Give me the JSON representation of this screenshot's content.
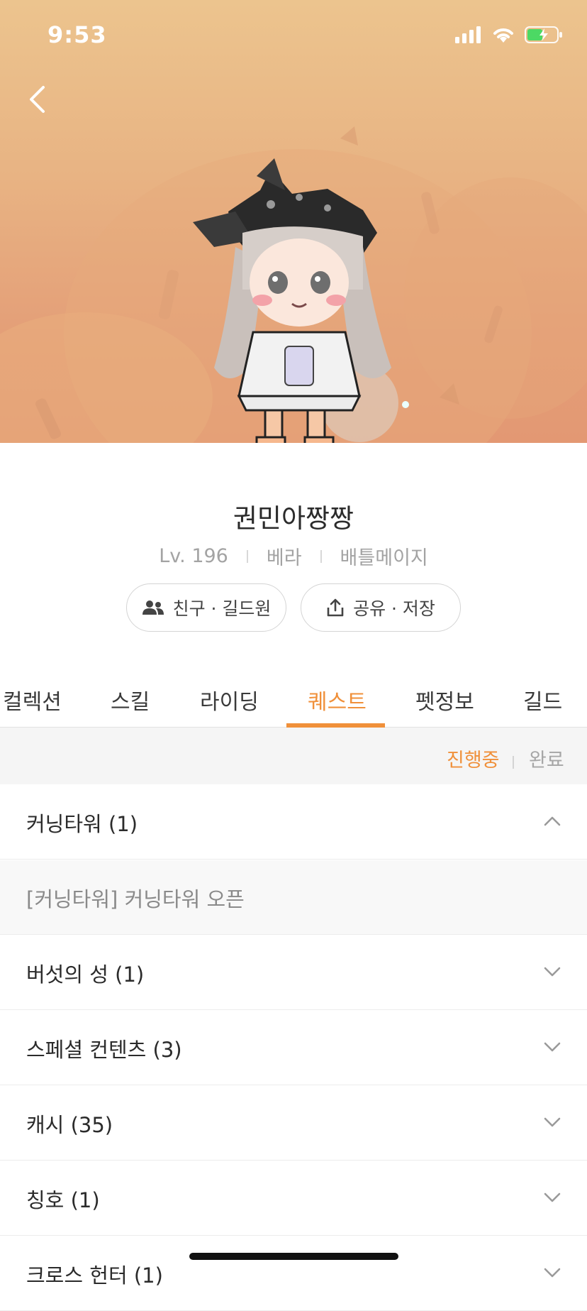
{
  "status_bar": {
    "time": "9:53"
  },
  "profile": {
    "name": "권민아짱짱",
    "level": "Lv. 196",
    "world": "베라",
    "job": "배틀메이지",
    "friend_button": "친구 · 길드원",
    "share_button": "공유 · 저장"
  },
  "tabs": [
    "컬렉션",
    "스킬",
    "라이딩",
    "퀘스트",
    "펫정보",
    "길드"
  ],
  "active_tab": "퀘스트",
  "filter": {
    "in_progress": "진행중",
    "done": "완료"
  },
  "quest_groups": [
    {
      "label": "커닝타워 (1)",
      "expanded": true
    },
    {
      "label": "[커닝타워] 커닝타워 오픈",
      "sub": true
    },
    {
      "label": "버섯의 성 (1)"
    },
    {
      "label": "스페셜 컨텐츠 (3)"
    },
    {
      "label": "캐시 (35)"
    },
    {
      "label": "칭호 (1)"
    },
    {
      "label": "크로스 헌터 (1)"
    }
  ],
  "colors": {
    "accent": "#f0903a",
    "hero_top": "#ecc48e",
    "hero_bottom": "#e39873"
  },
  "icons": [
    "back-icon",
    "signal-icon",
    "wifi-icon",
    "battery-icon",
    "friends-icon",
    "share-icon",
    "chevron-up-icon",
    "chevron-down-icon"
  ]
}
